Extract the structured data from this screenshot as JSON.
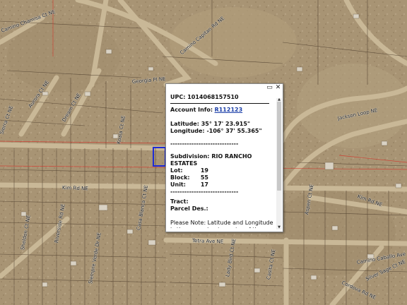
{
  "map": {
    "colors": {
      "terrain": "#a89474",
      "road": "#c9b897",
      "parcel_line": "#4a3a2a",
      "selection": "#1e2bd6",
      "boundary": "#d13b2f"
    },
    "road_labels": [
      "Camino Chamisa Ct NE",
      "Camino Capitan Rd NE",
      "Georgia Pl NE",
      "Jackson Loop NE",
      "Aurora Ct NE",
      "Dream Ct NE",
      "Koala Ct NE",
      "Kim Rd NE",
      "Tetra Ave NE",
      "Sierra Ct NE",
      "Sheldon Ct NE",
      "Riverside Rd NE",
      "Casa Blanca Ct NE",
      "Lady Bird Ct NE",
      "Casita Ct NE",
      "Kim Rd NE",
      "Aspen Ct NE",
      "Cordova Rd NE",
      "Siempre Verde Dr NE",
      "Silver Sage Ct NE",
      "Camino Caballo Ave NE"
    ]
  },
  "popup": {
    "upc_label": "UPC:",
    "upc_value": "1014068157510",
    "account_label": "Account Info:",
    "account_value": "R112123",
    "latitude_label": "Latitude:",
    "latitude_value": "35° 17' 23.915\"",
    "longitude_label": "Longitude:",
    "longitude_value": "-106° 37' 55.365\"",
    "separator": "-----------------------------",
    "subdivision_label": "Subdivision:",
    "subdivision_value": "RIO RANCHO ESTATES",
    "lot_label": "Lot:",
    "lot_value": "19",
    "block_label": "Block:",
    "block_value": "55",
    "unit_label": "Unit:",
    "unit_value": "17",
    "tract_label": "Tract:",
    "parcel_label": "Parcel Des.:",
    "note": "Please Note: Latitude and Longitude is the approximate center of the parcel shown.",
    "minimize_icon": "minimize-icon",
    "close_icon": "close-icon"
  }
}
